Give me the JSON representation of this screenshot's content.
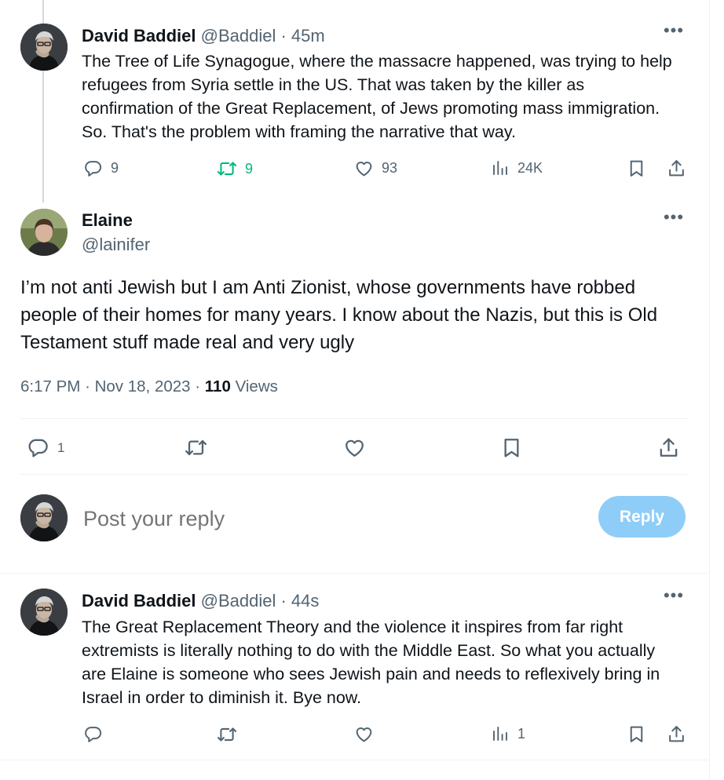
{
  "colors": {
    "accent": "#1d9bf0",
    "reply_button_bg": "#8ecdf8",
    "repost_active": "#00ba7c",
    "muted": "#536471",
    "text": "#0f1419"
  },
  "tweet1": {
    "name": "David Baddiel",
    "handle": "@Baddiel",
    "separator": "·",
    "time": "45m",
    "text": "The Tree of Life Synagogue, where the massacre happened, was trying to help refugees from Syria settle in the US. That was taken by the killer as confirmation of the Great Replacement, of Jews promoting mass immigration. So. That's the problem with framing the narrative that way.",
    "replies": "9",
    "reposts": "9",
    "likes": "93",
    "views": "24K"
  },
  "main": {
    "name": "Elaine",
    "handle": "@lainifer",
    "text": "I’m not anti Jewish but I am Anti Zionist, whose governments have robbed people of their homes for many years. I know about the Nazis, but this is Old Testament stuff made real and very ugly",
    "time": "6:17 PM",
    "separator": "·",
    "date": "Nov 18, 2023",
    "separator2": "·",
    "views_count": "110",
    "views_label": "Views",
    "replies": "1"
  },
  "composer": {
    "placeholder": "Post your reply",
    "button_label": "Reply"
  },
  "tweet2": {
    "name": "David Baddiel",
    "handle": "@Baddiel",
    "separator": "·",
    "time": "44s",
    "text": "The Great Replacement Theory and the violence it inspires from far right extremists is literally nothing to do with the Middle East. So what you actually are Elaine is someone who sees Jewish pain and needs to reflexively bring in Israel in order to diminish it. Bye now.",
    "views": "1"
  },
  "icons": {
    "more": "more-icon",
    "reply": "reply-icon",
    "repost": "repost-icon",
    "like": "like-icon",
    "views": "views-icon",
    "bookmark": "bookmark-icon",
    "share": "share-icon"
  }
}
